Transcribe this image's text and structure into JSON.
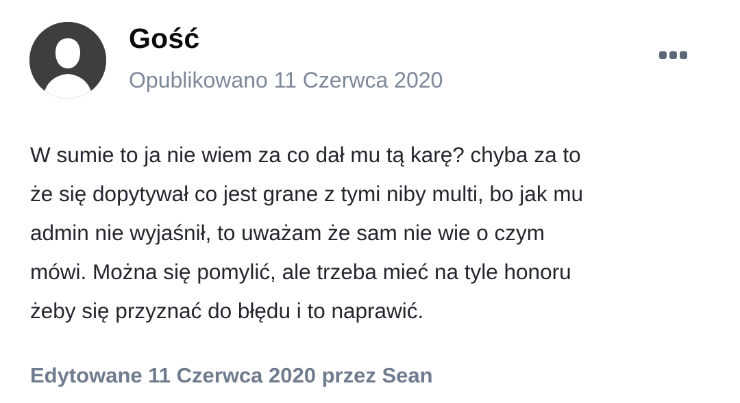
{
  "post": {
    "author": "Gość",
    "published": "Opublikowano 11 Czerwca 2020",
    "menu_icon": "ellipsis-menu-icon",
    "avatar_icon": "default-user-silhouette-icon",
    "body_lines": [
      "W sumie to ja nie wiem za co dał mu tą karę? chyba za to",
      "że się dopytywał co jest grane z tymi niby multi, bo jak mu",
      "admin nie wyjaśnił, to uważam że sam nie wie o czym",
      "mówi. Można się pomylić, ale trzeba mieć na tyle honoru",
      "żeby się przyznać do błędu i to naprawić."
    ],
    "edited": "Edytowane 11 Czerwca 2020 przez Sean"
  },
  "colors": {
    "author": "#0a0a0a",
    "meta": "#7d8899",
    "body": "#23272d",
    "edited": "#6f7b8e",
    "avatar_bg": "#3e3e3e",
    "menu_dots": "#5c6778"
  }
}
